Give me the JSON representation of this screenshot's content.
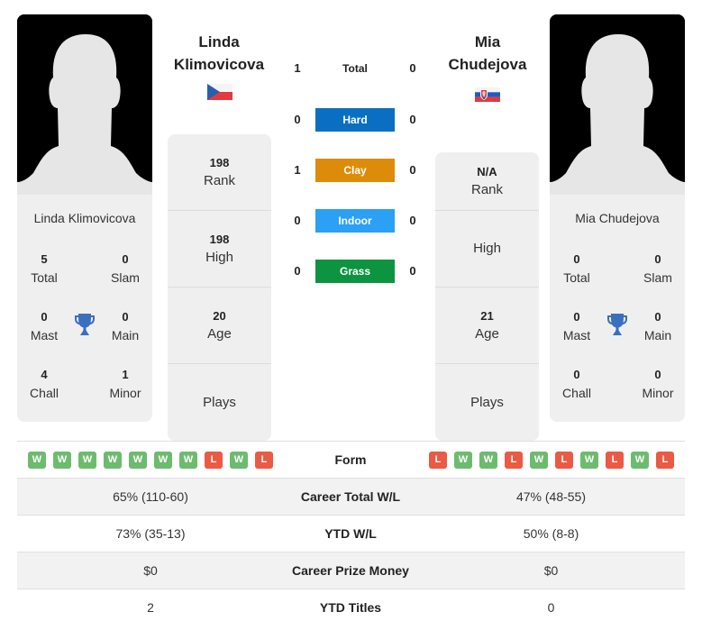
{
  "colors": {
    "hard": "#0a6fc2",
    "clay": "#dd8c0a",
    "indoor": "#2ba0f4",
    "grass": "#0d9440",
    "win": "#6dbb6f",
    "loss": "#ea5a44",
    "trophy": "#3a6fbf"
  },
  "player1": {
    "name_line1": "Linda",
    "name_line2": "Klimovicova",
    "full_name": "Linda Klimovicova",
    "flag": "czech-republic-flag",
    "titles": {
      "total": "5",
      "total_label": "Total",
      "slam": "0",
      "slam_label": "Slam",
      "mast": "0",
      "mast_label": "Mast",
      "main": "0",
      "main_label": "Main",
      "chall": "4",
      "chall_label": "Chall",
      "minor": "1",
      "minor_label": "Minor"
    },
    "stats": [
      {
        "value": "198",
        "label": "Rank"
      },
      {
        "value": "198",
        "label": "High"
      },
      {
        "value": "20",
        "label": "Age"
      },
      {
        "value": "",
        "label": "Plays"
      }
    ],
    "form": [
      "W",
      "W",
      "W",
      "W",
      "W",
      "W",
      "W",
      "L",
      "W",
      "L"
    ]
  },
  "player2": {
    "name_line1": "Mia",
    "name_line2": "Chudejova",
    "full_name": "Mia Chudejova",
    "flag": "slovakia-flag",
    "titles": {
      "total": "0",
      "total_label": "Total",
      "slam": "0",
      "slam_label": "Slam",
      "mast": "0",
      "mast_label": "Mast",
      "main": "0",
      "main_label": "Main",
      "chall": "0",
      "chall_label": "Chall",
      "minor": "0",
      "minor_label": "Minor"
    },
    "stats": [
      {
        "value": "N/A",
        "label": "Rank"
      },
      {
        "value": "",
        "label": "High"
      },
      {
        "value": "21",
        "label": "Age"
      },
      {
        "value": "",
        "label": "Plays"
      }
    ],
    "form": [
      "L",
      "W",
      "W",
      "L",
      "W",
      "L",
      "W",
      "L",
      "W",
      "L"
    ]
  },
  "h2h": [
    {
      "label": "Total",
      "p1": "1",
      "p2": "0",
      "surface": "total"
    },
    {
      "label": "Hard",
      "p1": "0",
      "p2": "0",
      "surface": "hard"
    },
    {
      "label": "Clay",
      "p1": "1",
      "p2": "0",
      "surface": "clay"
    },
    {
      "label": "Indoor",
      "p1": "0",
      "p2": "0",
      "surface": "indoor"
    },
    {
      "label": "Grass",
      "p1": "0",
      "p2": "0",
      "surface": "grass"
    }
  ],
  "comparison": {
    "form_label": "Form",
    "rows": [
      {
        "label": "Career Total W/L",
        "p1": "65% (110-60)",
        "p2": "47% (48-55)"
      },
      {
        "label": "YTD W/L",
        "p1": "73% (35-13)",
        "p2": "50% (8-8)"
      },
      {
        "label": "Career Prize Money",
        "p1": "$0",
        "p2": "$0"
      },
      {
        "label": "YTD Titles",
        "p1": "2",
        "p2": "0"
      }
    ]
  }
}
